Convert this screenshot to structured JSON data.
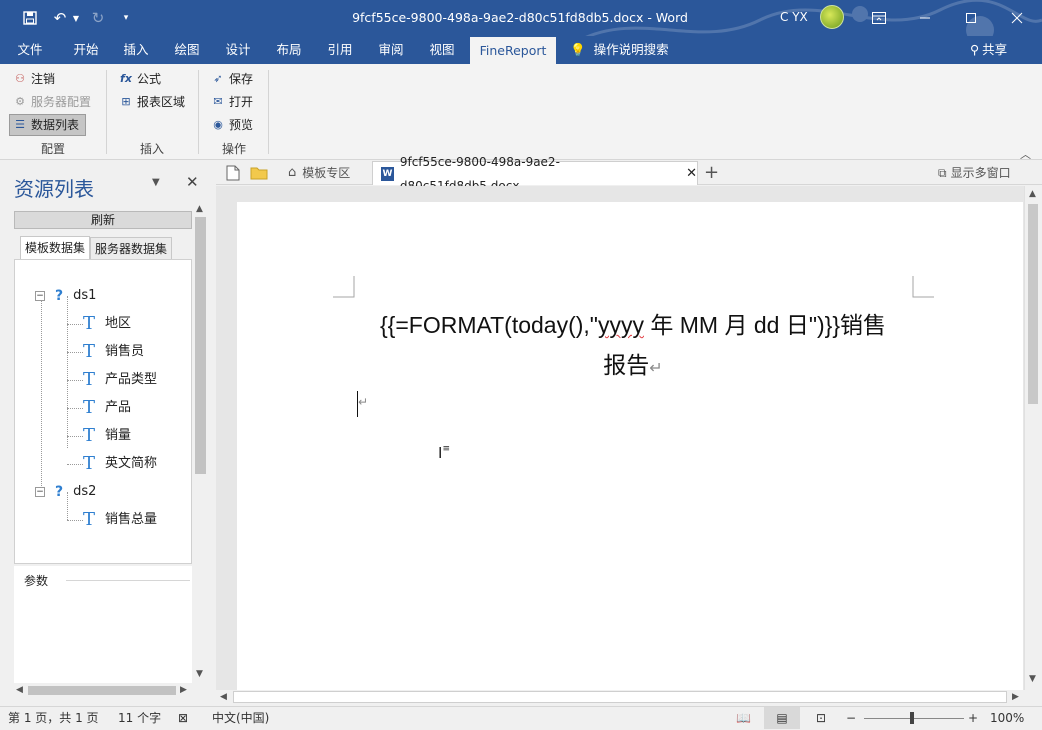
{
  "window": {
    "title": "9fcf55ce-9800-498a-9ae2-d80c51fd8db5.docx  -  Word",
    "user": "C YX"
  },
  "ribbon_tabs": [
    "文件",
    "开始",
    "插入",
    "绘图",
    "设计",
    "布局",
    "引用",
    "审阅",
    "视图",
    "FineReport"
  ],
  "tell_me": "操作说明搜索",
  "share": "共享",
  "ribbon": {
    "config": {
      "logout": "注销",
      "server_config": "服务器配置",
      "data_list": "数据列表",
      "label": "配置"
    },
    "insert": {
      "formula": "公式",
      "report_region": "报表区域",
      "label": "插入"
    },
    "operate": {
      "save": "保存",
      "open": "打开",
      "preview": "预览",
      "label": "操作"
    }
  },
  "panel": {
    "title": "资源列表",
    "refresh": "刷新",
    "tabs": [
      "模板数据集",
      "服务器数据集"
    ],
    "tree": [
      {
        "name": "ds1",
        "fields": [
          "地区",
          "销售员",
          "产品类型",
          "产品",
          "销量",
          "英文简称"
        ]
      },
      {
        "name": "ds2",
        "fields": [
          "销售总量"
        ]
      }
    ],
    "params_label": "参数"
  },
  "doc_tabs": {
    "template_zone": "模板专区",
    "active_doc": "9fcf55ce-9800-498a-9ae2-d80c51fd8db5.docx",
    "multi_window": "显示多窗口"
  },
  "document": {
    "line1_prefix": "{{=FORMAT(today(),\"",
    "line1_squiggle": "yyyy",
    "line1_suffix": " 年 MM 月 dd 日\")}}销售",
    "line2": "报告"
  },
  "status": {
    "page": "第 1 页，共 1 页",
    "words": "11 个字",
    "language": "中文(中国)",
    "zoom": "100%",
    "zoom_level": 100
  },
  "colors": {
    "word_blue": "#2b579a",
    "icon_blue": "#2f7fd0"
  }
}
